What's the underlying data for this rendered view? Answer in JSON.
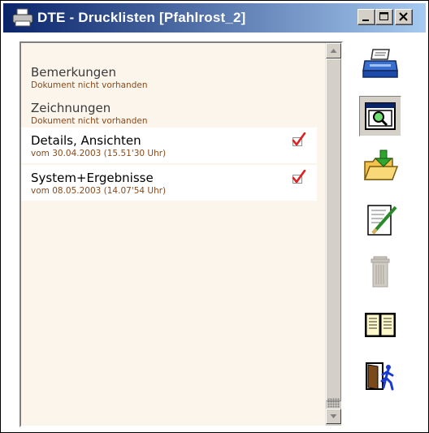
{
  "window": {
    "title": "DTE - Drucklisten  [Pfahlrost_2]"
  },
  "list": {
    "items": [
      {
        "name": "Bemerkungen",
        "sub": "Dokument nicht vorhanden",
        "checked": false
      },
      {
        "name": "Zeichnungen",
        "sub": "Dokument nicht vorhanden",
        "checked": false
      },
      {
        "name": "Details, Ansichten",
        "sub": "vom 30.04.2003 (15.51'30 Uhr)",
        "checked": true
      },
      {
        "name": "System+Ergebnisse",
        "sub": "vom 08.05.2003 (14.07'54 Uhr)",
        "checked": true
      }
    ]
  },
  "toolbar": [
    {
      "icon": "printer-icon"
    },
    {
      "icon": "preview-magnifier-icon",
      "pressed": true
    },
    {
      "icon": "folder-import-icon"
    },
    {
      "icon": "edit-document-icon"
    },
    {
      "icon": "trash-icon",
      "disabled": true
    },
    {
      "icon": "book-icon"
    },
    {
      "icon": "exit-door-icon"
    }
  ],
  "colors": {
    "title_bar_start": "#0a246a",
    "title_bar_end": "#a6caf0",
    "list_background": "#fbf5ec",
    "sub_text": "#8a4a1a",
    "check_mark": "#e02020"
  }
}
